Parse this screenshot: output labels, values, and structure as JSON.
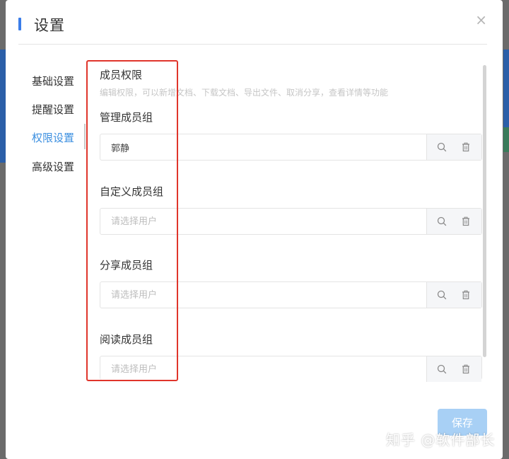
{
  "modal": {
    "title": "设置",
    "close_glyph": "×"
  },
  "nav": {
    "items": [
      {
        "label": "基础设置",
        "active": false
      },
      {
        "label": "提醒设置",
        "active": false
      },
      {
        "label": "权限设置",
        "active": true
      },
      {
        "label": "高级设置",
        "active": false
      }
    ]
  },
  "permissions": {
    "section_title": "成员权限",
    "section_desc": "编辑权限，可以新增文档、下载文档、导出文件、取消分享，查看详情等功能",
    "groups": [
      {
        "label": "管理成员组",
        "value": "郭静",
        "placeholder": "请选择用户"
      },
      {
        "label": "自定义成员组",
        "value": "",
        "placeholder": "请选择用户"
      },
      {
        "label": "分享成员组",
        "value": "",
        "placeholder": "请选择用户"
      },
      {
        "label": "阅读成员组",
        "value": "",
        "placeholder": "请选择用户"
      }
    ],
    "icons": {
      "search": "search-icon",
      "delete": "trash-icon"
    }
  },
  "footer": {
    "save_label": "保存"
  },
  "watermark": "知乎 @软件部长",
  "colors": {
    "accent": "#3b7de9",
    "active_nav": "#3b8fe0",
    "highlight": "#e0352b",
    "save_button": "#a8d0f5"
  }
}
